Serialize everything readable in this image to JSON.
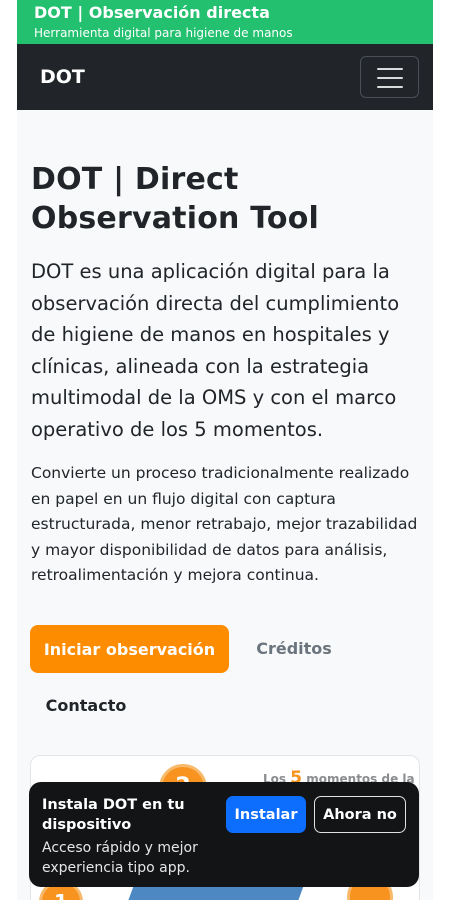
{
  "topbar": {
    "title": "DOT | Observación directa",
    "subtitle": "Herramienta digital para higiene de manos"
  },
  "navbar": {
    "brand": "DOT",
    "menu_icon": "hamburger-menu-icon"
  },
  "hero": {
    "title": "DOT | Direct Observation Tool",
    "lead": "DOT es una aplicación digital para la observación directa del cumplimiento de higiene de manos en hospitales y clínicas, alineada con la estrategia multimodal de la OMS y con el marco operativo de los 5 momentos.",
    "paragraph": "Convierte un proceso tradicionalmente realizado en papel en un flujo digital con captura estructurada, menor retrabajo, mejor trazabilidad y mayor disponibilidad de datos para análisis, retroalimentación y mejora continua."
  },
  "actions": {
    "start_label": "Iniciar observación",
    "credits_label": "Créditos",
    "contact_label": "Contacto"
  },
  "image_card": {
    "title_prefix": "Los",
    "title_number": "5",
    "title_suffix": "momentos de la",
    "circle_top": "2",
    "circle_bottom": "1"
  },
  "install_prompt": {
    "title": "Instala DOT en tu dispositivo",
    "subtitle": "Acceso rápido y mejor experiencia tipo app.",
    "install_label": "Instalar",
    "dismiss_label": "Ahora no"
  },
  "colors": {
    "topbar": "#22c06f",
    "navbar": "#212529",
    "primary_action": "#fd8c00",
    "install_button": "#0d6efd"
  }
}
